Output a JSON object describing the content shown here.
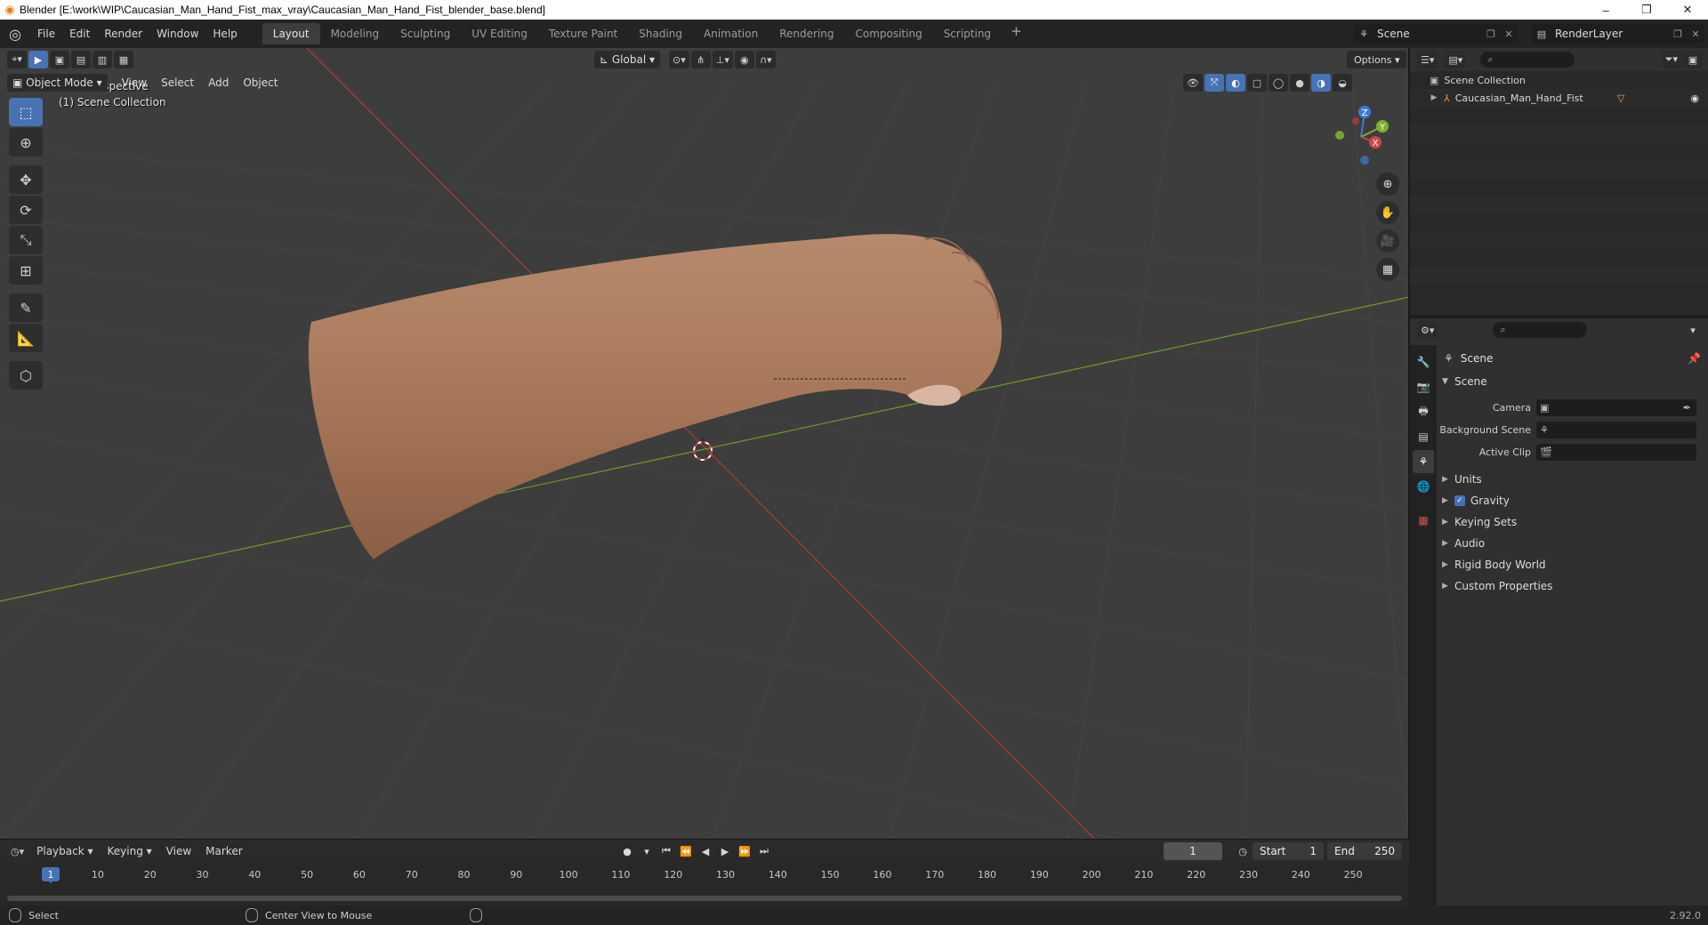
{
  "window": {
    "title": "Blender [E:\\work\\WIP\\Caucasian_Man_Hand_Fist_max_vray\\Caucasian_Man_Hand_Fist_blender_base.blend]",
    "minimize": "–",
    "maximize": "❐",
    "close": "✕"
  },
  "menu": [
    "File",
    "Edit",
    "Render",
    "Window",
    "Help"
  ],
  "workspaces": [
    "Layout",
    "Modeling",
    "Sculpting",
    "UV Editing",
    "Texture Paint",
    "Shading",
    "Animation",
    "Rendering",
    "Compositing",
    "Scripting"
  ],
  "active_workspace": "Layout",
  "scene_name": "Scene",
  "render_layer": "RenderLayer",
  "viewport": {
    "mode": "Object Mode",
    "menus": [
      "View",
      "Select",
      "Add",
      "Object"
    ],
    "orientation": "Global",
    "options_label": "Options",
    "overlay_line1": "User Perspective",
    "overlay_line2": "(1) Scene Collection",
    "gizmo_axes": {
      "z": "Z",
      "y": "Y",
      "x": "X"
    },
    "accent": "#4772b3",
    "x_axis_color": "#b03a3a",
    "y_axis_color": "#6f9a2a"
  },
  "timeline": {
    "menus": [
      "Playback",
      "Keying",
      "View",
      "Marker"
    ],
    "current_frame": "1",
    "start_label": "Start",
    "start_value": "1",
    "end_label": "End",
    "end_value": "250",
    "ticks": [
      "1",
      "10",
      "20",
      "30",
      "40",
      "50",
      "60",
      "70",
      "80",
      "90",
      "100",
      "110",
      "120",
      "130",
      "140",
      "150",
      "160",
      "170",
      "180",
      "190",
      "200",
      "210",
      "220",
      "230",
      "240",
      "250"
    ]
  },
  "statusbar": {
    "select": "Select",
    "center_view": "Center View to Mouse",
    "version": "2.92.0"
  },
  "outliner": {
    "root": "Scene Collection",
    "object": "Caucasian_Man_Hand_Fist"
  },
  "properties": {
    "title": "Scene",
    "panel": "Scene",
    "camera_label": "Camera",
    "bg_scene_label": "Background Scene",
    "active_clip_label": "Active Clip",
    "subpanels": [
      "Units",
      "Gravity",
      "Keying Sets",
      "Audio",
      "Rigid Body World",
      "Custom Properties"
    ]
  }
}
